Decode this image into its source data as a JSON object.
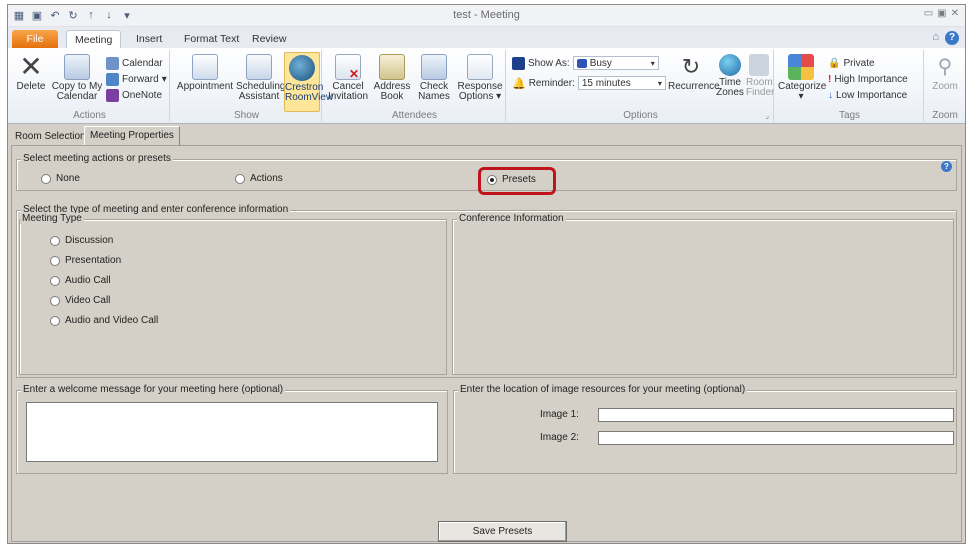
{
  "window": {
    "title": "test - Meeting"
  },
  "tabs": [
    {
      "label": "File"
    },
    {
      "label": "Meeting"
    },
    {
      "label": "Insert"
    },
    {
      "label": "Format Text"
    },
    {
      "label": "Review"
    }
  ],
  "ribbon": {
    "actions": {
      "label": "Actions",
      "delete": "Delete",
      "copy_to_my_calendar": "Copy to My Calendar",
      "calendar": "Calendar",
      "forward": "Forward",
      "onenote": "OneNote"
    },
    "show": {
      "label": "Show",
      "appointment": "Appointment",
      "scheduling_assistant": "Scheduling Assistant",
      "crestron_roomview": "Crestron RoomView"
    },
    "attendees": {
      "label": "Attendees",
      "cancel_invitation": "Cancel Invitation",
      "address_book": "Address Book",
      "check_names": "Check Names",
      "response_options": "Response Options"
    },
    "options": {
      "label": "Options",
      "show_as_label": "Show As:",
      "show_as_value": "Busy",
      "reminder_label": "Reminder:",
      "reminder_value": "15 minutes",
      "recurrence": "Recurrence",
      "time_zones": "Time Zones",
      "room_finder": "Room Finder"
    },
    "tags": {
      "label": "Tags",
      "categorize": "Categorize",
      "private": "Private",
      "high_importance": "High Importance",
      "low_importance": "Low Importance"
    },
    "zoom": {
      "label": "Zoom",
      "zoom": "Zoom"
    }
  },
  "panel_tabs": [
    {
      "label": "Room Selection"
    },
    {
      "label": "Meeting Properties"
    }
  ],
  "actions_section": {
    "legend": "Select meeting actions or presets",
    "options": [
      "None",
      "Actions",
      "Presets"
    ],
    "selected": "Presets"
  },
  "meeting_section": {
    "legend": "Select the type of meeting and enter conference information",
    "meeting_type": {
      "legend": "Meeting Type",
      "options": [
        "Discussion",
        "Presentation",
        "Audio Call",
        "Video Call",
        "Audio and Video Call"
      ]
    },
    "conference": {
      "legend": "Conference Information"
    }
  },
  "welcome": {
    "legend": "Enter a welcome message for your meeting here (optional)",
    "value": ""
  },
  "images": {
    "legend": "Enter the location of image resources for your meeting (optional)",
    "image1_label": "Image 1:",
    "image2_label": "Image 2:",
    "image1_value": "",
    "image2_value": ""
  },
  "save_button": "Save Presets",
  "colors": {
    "file_tab": "#e36c09",
    "highlight": "#c0141c",
    "crestron_active": "#fde59a"
  }
}
